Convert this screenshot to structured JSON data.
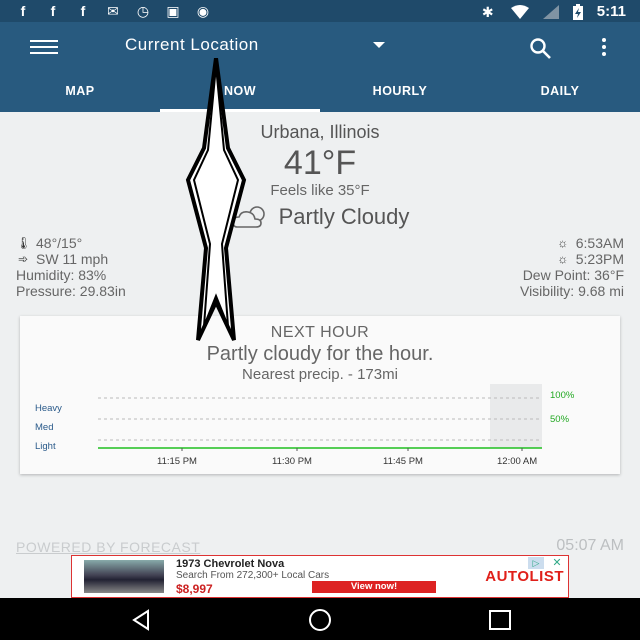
{
  "status_bar": {
    "left_icons": [
      "facebook-icon",
      "facebook-icon",
      "facebook-icon",
      "fax-icon",
      "clock-icon",
      "lock-icon",
      "android-icon"
    ],
    "right_icons": [
      "bluetooth-icon",
      "wifi-icon",
      "signal-icon",
      "battery-icon"
    ],
    "time": "5:11"
  },
  "app_bar": {
    "title": "Current Location",
    "tabs": [
      {
        "label": "MAP",
        "active": false
      },
      {
        "label": "NOW",
        "active": true
      },
      {
        "label": "HOURLY",
        "active": false
      },
      {
        "label": "DAILY",
        "active": false
      }
    ]
  },
  "current": {
    "city": "Urbana, Illinois",
    "temperature": "41°F",
    "feels_like": "Feels like 35°F",
    "condition": "Partly Cloudy",
    "condition_icon": "partly-cloudy-icon"
  },
  "stats_left": {
    "hi_lo": "48°/15°",
    "wind": "SW 11 mph",
    "humidity": "Humidity: 83%",
    "pressure": "Pressure: 29.83in"
  },
  "stats_right": {
    "sunrise": "6:53AM",
    "sunset": "5:23PM",
    "dew_point": "Dew Point: 36°F",
    "visibility": "Visibility: 9.68 mi"
  },
  "next_hour": {
    "heading": "NEXT HOUR",
    "summary": "Partly cloudy for the hour.",
    "nearest": "Nearest precip. - 173mi"
  },
  "chart_data": {
    "type": "area",
    "y_categories": [
      "Heavy",
      "Med",
      "Light"
    ],
    "right_labels": [
      "100%",
      "50%"
    ],
    "x_ticks": [
      "11:15 PM",
      "11:30 PM",
      "11:45 PM",
      "12:00 AM"
    ],
    "precip_intensity": [
      0,
      0,
      0,
      0,
      0
    ],
    "grid": true
  },
  "footer": {
    "powered_by": "POWERED BY FORECAST",
    "updated": "05:07 AM"
  },
  "ad": {
    "title": "1973 Chevrolet Nova",
    "subtitle": "Search From 272,300+ Local Cars",
    "price": "$8,997",
    "cta": "View now!",
    "brand": "AUTOLIST",
    "close": "✕"
  },
  "colors": {
    "status_bar": "#1f4a6a",
    "app_bar": "#285a7f",
    "chart_line": "#1fbf1f",
    "accent_green": "#22a822"
  }
}
